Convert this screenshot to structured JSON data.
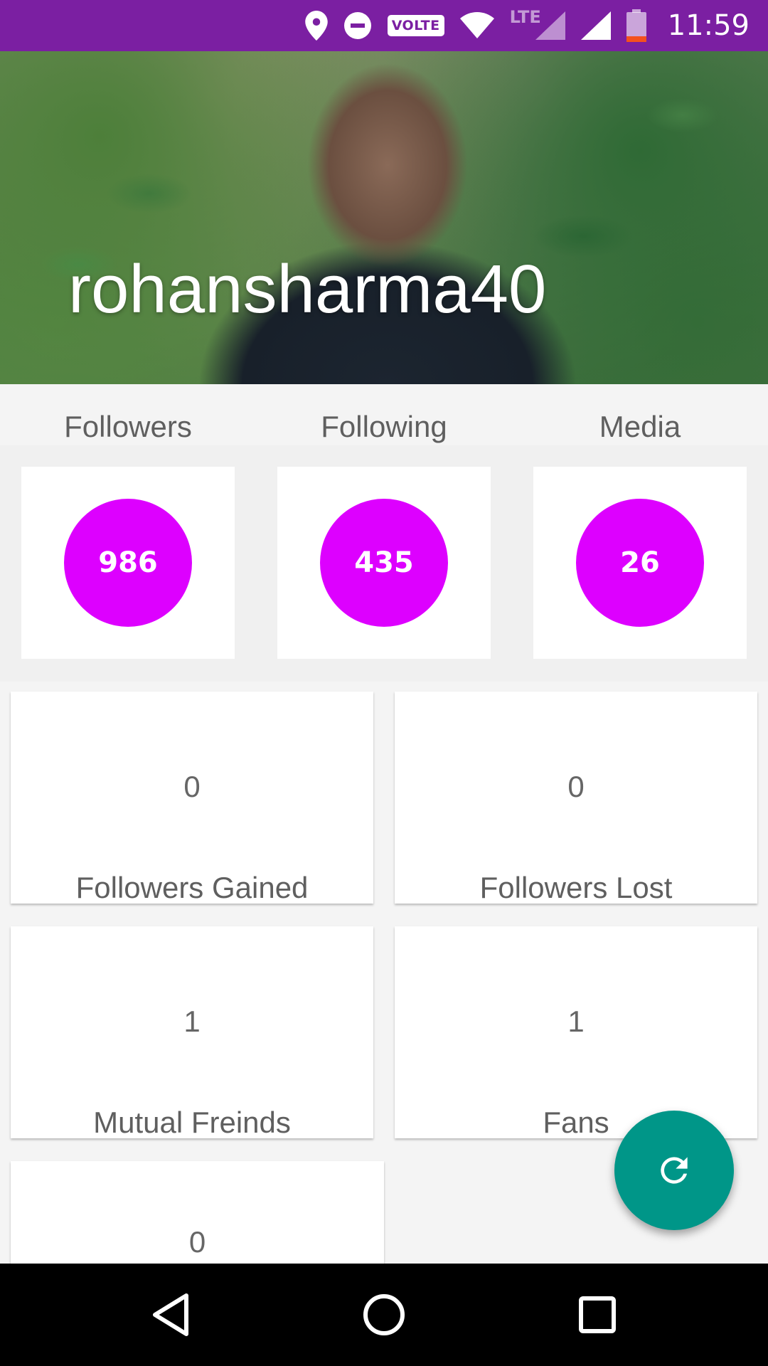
{
  "status_bar": {
    "network_label": "VOLTE",
    "lte_label": "LTE",
    "time": "11:59",
    "icons": [
      "location-icon",
      "do-not-disturb-icon",
      "volte-icon",
      "wifi-icon",
      "lte-signal-icon",
      "cell-signal-icon",
      "battery-icon"
    ]
  },
  "profile": {
    "username": "rohansharma40"
  },
  "stats": {
    "labels": [
      "Followers",
      "Following",
      "Media"
    ],
    "values": [
      "986",
      "435",
      "26"
    ]
  },
  "metrics": [
    {
      "value": "0",
      "label": "Followers Gained"
    },
    {
      "value": "0",
      "label": "Followers Lost"
    },
    {
      "value": "1",
      "label": "Mutual Freinds"
    },
    {
      "value": "1",
      "label": "Fans"
    },
    {
      "value": "0",
      "label": ""
    }
  ],
  "fab": {
    "icon": "refresh-icon"
  },
  "navigation": {
    "icons": [
      "back-icon",
      "home-icon",
      "recents-icon"
    ]
  },
  "colors": {
    "status_bar": "#7b1fa2",
    "circle": "#dd00ff",
    "fab": "#009688",
    "nav_bar": "#000000"
  }
}
